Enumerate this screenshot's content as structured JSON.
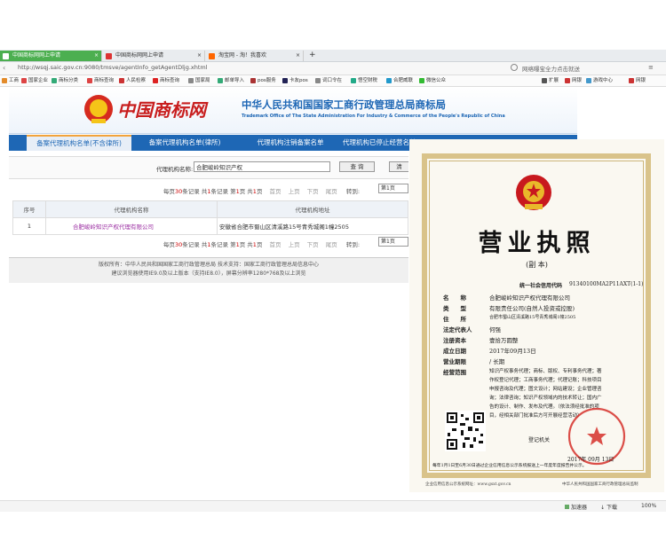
{
  "browser": {
    "tabs": [
      {
        "label": "中国商标网网上申请",
        "active": true
      },
      {
        "label": "中国商标网网上申请",
        "active": false
      },
      {
        "label": "淘宝网 - 淘！我喜欢",
        "active": false
      }
    ],
    "new_tab": "+",
    "url": "http://wsqj.saic.gov.cn:9080/tmsve/agentInfo_getAgentDljg.xhtml",
    "search_hint": "网络曝宝全力点击就送",
    "bookmarks": [
      "工商",
      "国家企业",
      "商标分类",
      "商标查询",
      "人民检察",
      "商标查询",
      "国家局",
      "邮单导入",
      "pos服务",
      "卡友pos",
      "词口令在",
      "悟空财税",
      "合肥威联",
      "微信公众"
    ],
    "right_tools": [
      "扩展",
      "网银",
      "游戏中心",
      "网银"
    ]
  },
  "site": {
    "logo_text": "中国商标网",
    "title": "中华人民共和国国家工商行政管理总局商标局",
    "subtitle": "Trademark Office of The State Administration For Industry & Commerce of the People's Republic of China",
    "tabs": [
      "备案代理机构名单(不含律所)",
      "备案代理机构名单(律所)",
      "代理机构注销备案名单",
      "代理机构已停止经营名单"
    ]
  },
  "search": {
    "label": "代理机构名称:",
    "value": "合肥峻岭知识产权",
    "query_button": "查 询",
    "reset_button": "清"
  },
  "pager": {
    "text": [
      "每页",
      "30",
      "条记录 共",
      "1",
      "条记录 第",
      "1",
      "页 共",
      "1",
      "页",
      "首页",
      "上页",
      "下页",
      "尾页",
      "转到:"
    ],
    "page_select": "第1页"
  },
  "table": {
    "headers": [
      "序号",
      "代理机构名称",
      "代理机构地址"
    ],
    "rows": [
      {
        "no": "1",
        "name": "合肥峻岭知识产权代理有限公司",
        "address": "安徽省合肥市蜀山区清溪路15号青秀城阁1幢2505"
      }
    ]
  },
  "footer": {
    "line1": "版权所有：中华人民共和国国家工商行政管理总局 技术支持：国家工商行政管理总局信息中心",
    "line2": "建议浏览器使用IE9.0及以上版本（支持IE8.0），屏幕分辨率1280*768及以上浏览"
  },
  "certificate": {
    "title": "营业执照",
    "sub": "(副 本)",
    "credit_label": "统一社会信用代码",
    "credit_code": "91340100MA2P11AXT(1-1)",
    "fields": [
      {
        "label": "名　　称",
        "value": "合肥峻岭知识产权代理有限公司"
      },
      {
        "label": "类　　型",
        "value": "有限责任公司(自然人投资或控股)"
      },
      {
        "label": "住　　所",
        "value": "合肥市蜀山区清溪路15号青秀城阁1幢2505"
      },
      {
        "label": "法定代表人",
        "value": "何强"
      },
      {
        "label": "注册资本",
        "value": "壹拾万圆整"
      },
      {
        "label": "成立日期",
        "value": "2017年09月13日"
      },
      {
        "label": "营业期限",
        "value": "/ 长期"
      },
      {
        "label": "经营范围",
        "value": "知识产权事务代理；商标、版权、专利事务代理；著"
      }
    ],
    "scope_lines": [
      "作权登记代理；工商事务代理；代理记账；科技项目",
      "申报咨询及代理；图文设计；网站建设；企业管理咨",
      "询；法律咨询；知识产权领域内的技术转让；国内广",
      "告的设计、制作、发布及代理。（依法须经批准的项",
      "目，经相关部门批准后方可开展经营活动）"
    ],
    "authority": "登记机关",
    "issue_date": "2017年 09月 13日",
    "seal_text": "合肥市蜀山区市场监督管理局",
    "notice": "每年1月1日至6月30日通过企业信用信息公示系统报送上一年度年度报告并公示。",
    "footer_left": "企业信用信息公示系统网址：www.gsxt.gov.cn",
    "footer_right": "中华人民共和国国家工商行政管理总局监制"
  },
  "statusbar": {
    "items": [
      "加速器",
      "下载",
      "100%"
    ]
  },
  "colors": {
    "nav": "#1e67b5",
    "accent": "#c00000",
    "frame": "#d9c38a"
  }
}
